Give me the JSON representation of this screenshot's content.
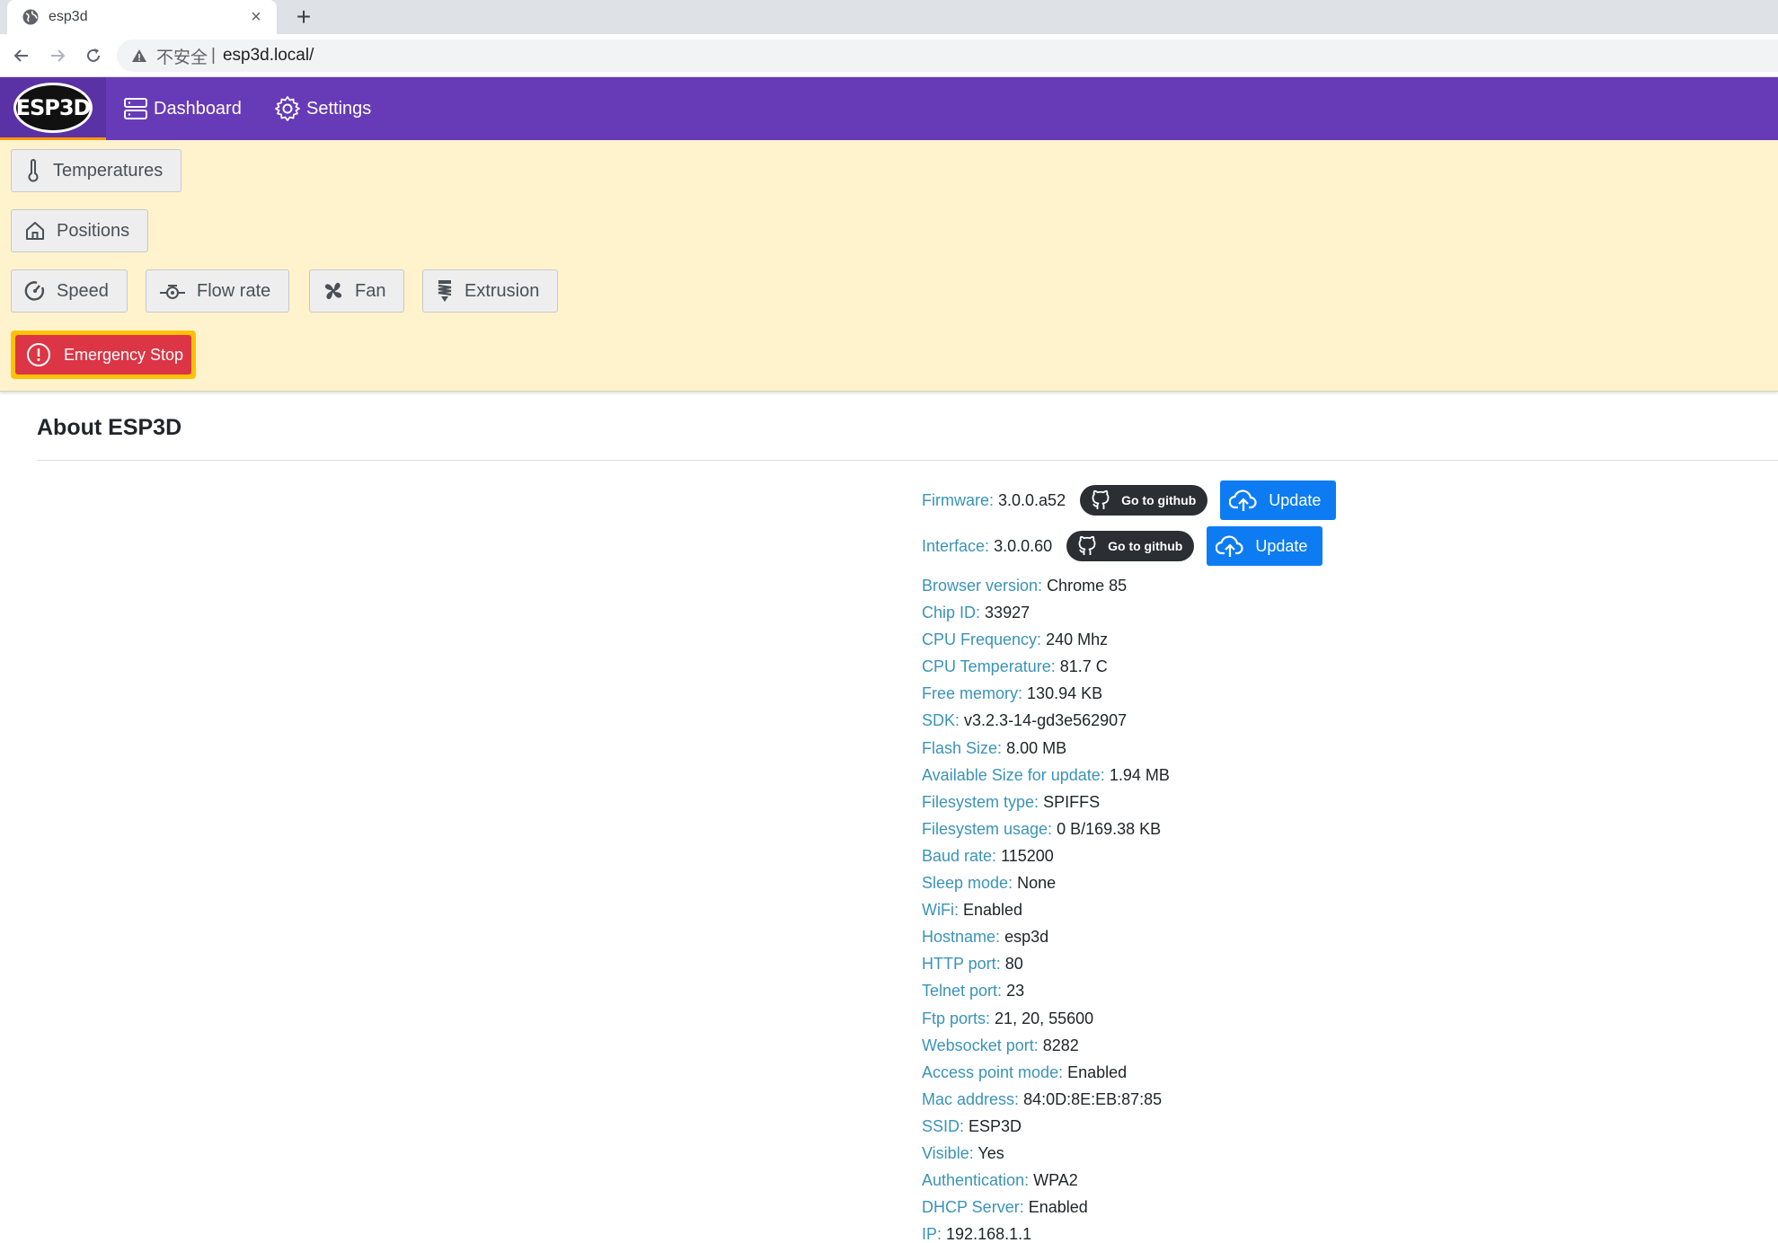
{
  "browser": {
    "tab_title": "esp3d",
    "tab_close": "×",
    "new_tab": "+",
    "insecure_label": "不安全",
    "separator": "|",
    "url": "esp3d.local/"
  },
  "navbar": {
    "logo_text": "ESP3D",
    "dashboard_label": "Dashboard",
    "settings_label": "Settings"
  },
  "controls": {
    "temperatures_label": "Temperatures",
    "positions_label": "Positions",
    "speed_label": "Speed",
    "flow_rate_label": "Flow rate",
    "fan_label": "Fan",
    "extrusion_label": "Extrusion",
    "emergency_stop_label": "Emergency Stop"
  },
  "about": {
    "title": "About ESP3D",
    "firmware": {
      "label": "Firmware:",
      "value": "3.0.0.a52"
    },
    "interface": {
      "label": "Interface:",
      "value": "3.0.0.60"
    },
    "github_label": "Go to github",
    "update_label": "Update",
    "info": [
      {
        "label": "Browser version:",
        "value": "Chrome 85"
      },
      {
        "label": "Chip ID:",
        "value": "33927"
      },
      {
        "label": "CPU Frequency:",
        "value": "240 Mhz"
      },
      {
        "label": "CPU Temperature:",
        "value": "81.7 C"
      },
      {
        "label": "Free memory:",
        "value": "130.94 KB"
      },
      {
        "label": "SDK:",
        "value": "v3.2.3-14-gd3e562907"
      },
      {
        "label": "Flash Size:",
        "value": "8.00 MB"
      },
      {
        "label": "Available Size for update:",
        "value": "1.94 MB"
      },
      {
        "label": "Filesystem type:",
        "value": "SPIFFS"
      },
      {
        "label": "Filesystem usage:",
        "value": "0 B/169.38 KB"
      },
      {
        "label": "Baud rate:",
        "value": "115200"
      },
      {
        "label": "Sleep mode:",
        "value": "None"
      },
      {
        "label": "WiFi:",
        "value": "Enabled"
      },
      {
        "label": "Hostname:",
        "value": "esp3d"
      },
      {
        "label": "HTTP port:",
        "value": "80"
      },
      {
        "label": "Telnet port:",
        "value": "23"
      },
      {
        "label": "Ftp ports:",
        "value": "21, 20, 55600"
      },
      {
        "label": "Websocket port:",
        "value": "8282"
      },
      {
        "label": "Access point mode:",
        "value": "Enabled"
      },
      {
        "label": "Mac address:",
        "value": "84:0D:8E:EB:87:85"
      },
      {
        "label": "SSID:",
        "value": "ESP3D"
      },
      {
        "label": "Visible:",
        "value": "Yes"
      },
      {
        "label": "Authentication:",
        "value": "WPA2"
      },
      {
        "label": "DHCP Server:",
        "value": "Enabled"
      },
      {
        "label": "IP:",
        "value": "192.168.1.1"
      }
    ]
  },
  "colors": {
    "navbar": "#673ab7",
    "panel": "#fff3cd",
    "label": "#3a93b8",
    "update_button": "#0d7cf2",
    "emergency": "#dc3545",
    "emergency_border": "#ffc107"
  },
  "icons": {
    "favicon": "globe-icon",
    "dashboard": "server-icon",
    "settings": "gear-icon",
    "temperatures": "thermometer-icon",
    "positions": "home-icon",
    "speed": "gauge-icon",
    "flow_rate": "flow-icon",
    "fan": "fan-icon",
    "extrusion": "extrusion-icon",
    "emergency": "alert-circle-icon",
    "github": "github-icon",
    "update": "cloud-upload-icon"
  }
}
